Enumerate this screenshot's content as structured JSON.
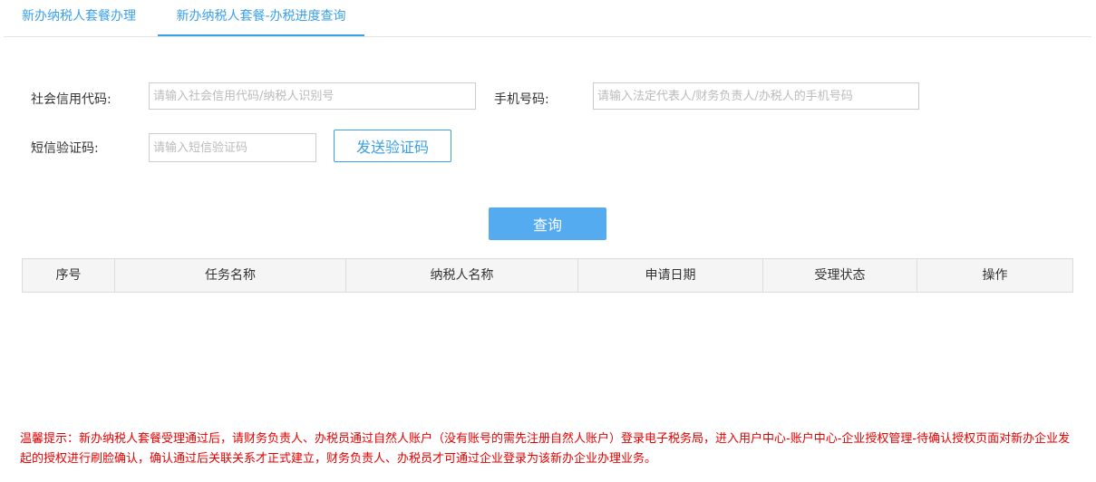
{
  "tabs": [
    {
      "label": "新办纳税人套餐办理"
    },
    {
      "label": "新办纳税人套餐-办税进度查询"
    }
  ],
  "form": {
    "credit_code_label": "社会信用代码:",
    "credit_code_placeholder": "请输入社会信用代码/纳税人识别号",
    "credit_code_value": "",
    "phone_label": "手机号码:",
    "phone_placeholder": "请输入法定代表人/财务负责人/办税人的手机号码",
    "phone_value": "",
    "sms_label": "短信验证码:",
    "sms_placeholder": "请输入短信验证码",
    "sms_value": "",
    "send_code_label": "发送验证码",
    "query_label": "查询"
  },
  "table": {
    "columns": [
      "序号",
      "任务名称",
      "纳税人名称",
      "申请日期",
      "受理状态",
      "操作"
    ],
    "rows": []
  },
  "tip": {
    "text": "温馨提示：新办纳税人套餐受理通过后，请财务负责人、办税员通过自然人账户（没有账号的需先注册自然人账户）登录电子税务局，进入用户中心-账户中心-企业授权管理-待确认授权页面对新办企业发起的授权进行刷脸确认，确认通过后关联关系才正式建立，财务负责人、办税员才可通过企业登录为该新办企业办理业务。"
  },
  "colors": {
    "accent": "#3aa0e8",
    "query_button": "#55abf0",
    "tip": "#e60000"
  }
}
